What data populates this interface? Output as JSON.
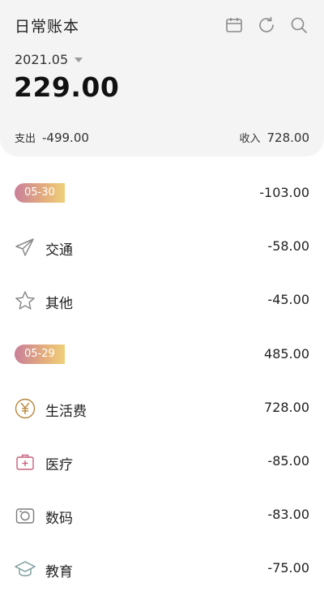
{
  "header": {
    "title": "日常账本",
    "icons": [
      "calendar-icon",
      "refresh-icon",
      "search-icon"
    ],
    "month": "2021.05",
    "balance": "229.00",
    "expense_label": "支出",
    "expense_value": "-499.00",
    "income_label": "收入",
    "income_value": "728.00"
  },
  "colors": {
    "header_bg": "#f4f4f4",
    "badge_gradient_start": "#c97f99",
    "badge_gradient_end": "#eed07a",
    "icon_stroke": "#8a8a8a"
  },
  "list": {
    "day1": {
      "date": "05-30",
      "total": "-103.00"
    },
    "day1_items": [
      {
        "icon": "paper-plane-icon",
        "label": "交通",
        "amount": "-58.00"
      },
      {
        "icon": "star-icon",
        "label": "其他",
        "amount": "-45.00"
      }
    ],
    "day2": {
      "date": "05-29",
      "total": "485.00"
    },
    "day2_items": [
      {
        "icon": "yen-coin-icon",
        "label": "生活费",
        "amount": "728.00"
      },
      {
        "icon": "medical-kit-icon",
        "label": "医疗",
        "amount": "-85.00"
      },
      {
        "icon": "camera-icon",
        "label": "数码",
        "amount": "-83.00"
      },
      {
        "icon": "graduation-cap-icon",
        "label": "教育",
        "amount": "-75.00"
      }
    ]
  }
}
